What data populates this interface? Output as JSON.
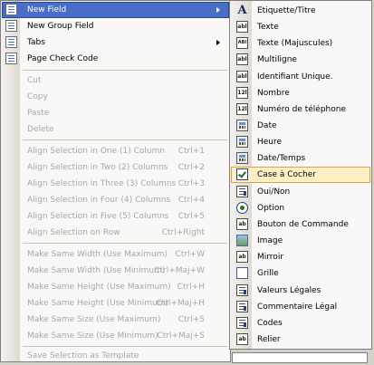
{
  "main_menu": {
    "items": [
      {
        "label": "New Field",
        "shortcut": "",
        "submenu": true,
        "disabled": false,
        "highlighted": true
      },
      {
        "label": "New Group Field",
        "shortcut": "",
        "submenu": false,
        "disabled": false
      },
      {
        "label": "Tabs",
        "shortcut": "",
        "submenu": true,
        "disabled": false
      },
      {
        "label": "Page Check Code",
        "shortcut": "",
        "submenu": false,
        "disabled": false
      },
      {
        "label": "Cut",
        "shortcut": "",
        "disabled": true
      },
      {
        "label": "Copy",
        "shortcut": "",
        "disabled": true
      },
      {
        "label": "Paste",
        "shortcut": "",
        "disabled": true
      },
      {
        "label": "Delete",
        "shortcut": "",
        "disabled": true
      },
      {
        "label": "Align Selection in One (1) Column",
        "shortcut": "Ctrl+1",
        "disabled": true
      },
      {
        "label": "Align Selection in Two (2) Columns",
        "shortcut": "Ctrl+2",
        "disabled": true
      },
      {
        "label": "Align Selection in Three (3) Columns",
        "shortcut": "Ctrl+3",
        "disabled": true
      },
      {
        "label": "Align Selection in Four (4) Columns",
        "shortcut": "Ctrl+4",
        "disabled": true
      },
      {
        "label": "Align Selection in Five (5) Columns",
        "shortcut": "Ctrl+5",
        "disabled": true
      },
      {
        "label": "Align Selection on Row",
        "shortcut": "Ctrl+Right",
        "disabled": true
      },
      {
        "label": "Make Same Width (Use Maximum)",
        "shortcut": "Ctrl+W",
        "disabled": true
      },
      {
        "label": "Make Same Width (Use Minimum)",
        "shortcut": "Ctrl+Maj+W",
        "disabled": true
      },
      {
        "label": "Make Same Height (Use Maximum)",
        "shortcut": "Ctrl+H",
        "disabled": true
      },
      {
        "label": "Make Same Height (Use Minimum)",
        "shortcut": "Ctrl+Maj+H",
        "disabled": true
      },
      {
        "label": "Make Same Size (Use Maximum)",
        "shortcut": "Ctrl+S",
        "disabled": true
      },
      {
        "label": "Make Same Size (Use Minimum)",
        "shortcut": "Ctrl+Maj+S",
        "disabled": true
      },
      {
        "label": "Save Selection as Template",
        "shortcut": "",
        "disabled": true
      }
    ]
  },
  "submenu": {
    "items": [
      {
        "label": "Etiquette/Titre",
        "icon": "text-label-icon",
        "glyph": "A"
      },
      {
        "label": "Texte",
        "icon": "textbox-icon",
        "glyph": "abl"
      },
      {
        "label": "Texte (Majuscules)",
        "icon": "uppercase-textbox-icon",
        "glyph": "ABl"
      },
      {
        "label": "Multiligne",
        "icon": "multiline-icon",
        "glyph": "abl"
      },
      {
        "label": "Identifiant Unique.",
        "icon": "unique-id-icon",
        "glyph": "abl"
      },
      {
        "label": "Nombre",
        "icon": "number-icon",
        "glyph": "12l"
      },
      {
        "label": "Numéro de téléphone",
        "icon": "phone-number-icon",
        "glyph": "12l"
      },
      {
        "label": "Date",
        "icon": "date-icon",
        "glyph": ""
      },
      {
        "label": "Heure",
        "icon": "time-icon",
        "glyph": ""
      },
      {
        "label": "Date/Temps",
        "icon": "datetime-icon",
        "glyph": ""
      },
      {
        "label": "Case à Cocher",
        "icon": "checkbox-icon",
        "glyph": "",
        "highlighted": true
      },
      {
        "label": "Oui/Non",
        "icon": "yes-no-icon",
        "glyph": ""
      },
      {
        "label": "Option",
        "icon": "option-icon",
        "glyph": ""
      },
      {
        "label": "Bouton de Commande",
        "icon": "command-button-icon",
        "glyph": "ab"
      },
      {
        "label": "Image",
        "icon": "image-icon",
        "glyph": ""
      },
      {
        "label": "Mirroir",
        "icon": "mirror-icon",
        "glyph": "ab"
      },
      {
        "label": "Grille",
        "icon": "grid-icon",
        "glyph": ""
      },
      {
        "label": "Valeurs Légales",
        "icon": "legal-values-icon",
        "glyph": ""
      },
      {
        "label": "Commentaire Légal",
        "icon": "legal-comment-icon",
        "glyph": ""
      },
      {
        "label": "Codes",
        "icon": "codes-icon",
        "glyph": ""
      },
      {
        "label": "Relier",
        "icon": "relate-icon",
        "glyph": "ab"
      }
    ]
  }
}
